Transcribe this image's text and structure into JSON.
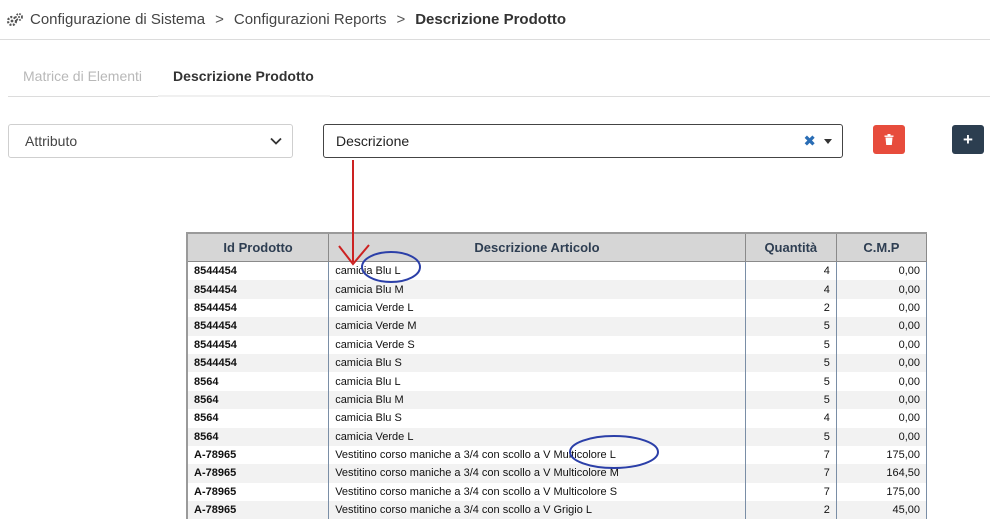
{
  "breadcrumb": {
    "items": [
      "Configurazione di Sistema",
      "Configurazioni Reports"
    ],
    "separator": ">",
    "current": "Descrizione Prodotto"
  },
  "tabs": [
    {
      "label": "Matrice di Elementi",
      "active": false
    },
    {
      "label": "Descrizione Prodotto",
      "active": true
    }
  ],
  "controls": {
    "attribute_select": "Attributo",
    "description_select": "Descrizione",
    "delete_icon": "trash-icon",
    "add_icon": "plus-icon",
    "add_symbol": "+"
  },
  "colors": {
    "delete_button": "#e74c3c",
    "add_button": "#2c3e50",
    "annotation_arrow": "#cc2222",
    "annotation_circle": "#2b3fa8"
  },
  "table": {
    "headers": [
      "Id Prodotto",
      "Descrizione Articolo",
      "Quantità",
      "C.M.P"
    ],
    "rows": [
      [
        "8544454",
        "camicia Blu L",
        "4",
        "0,00"
      ],
      [
        "8544454",
        "camicia Blu M",
        "4",
        "0,00"
      ],
      [
        "8544454",
        "camicia Verde L",
        "2",
        "0,00"
      ],
      [
        "8544454",
        "camicia Verde M",
        "5",
        "0,00"
      ],
      [
        "8544454",
        "camicia Verde S",
        "5",
        "0,00"
      ],
      [
        "8544454",
        "camicia Blu S",
        "5",
        "0,00"
      ],
      [
        "8564",
        "camicia Blu L",
        "5",
        "0,00"
      ],
      [
        "8564",
        "camicia Blu M",
        "5",
        "0,00"
      ],
      [
        "8564",
        "camicia Blu S",
        "4",
        "0,00"
      ],
      [
        "8564",
        "camicia Verde L",
        "5",
        "0,00"
      ],
      [
        "A-78965",
        "Vestitino corso maniche a 3/4 con scollo a V Multicolore L",
        "7",
        "175,00"
      ],
      [
        "A-78965",
        "Vestitino corso maniche a 3/4 con scollo a V Multicolore M",
        "7",
        "164,50"
      ],
      [
        "A-78965",
        "Vestitino corso maniche a 3/4 con scollo a V Multicolore S",
        "7",
        "175,00"
      ],
      [
        "A-78965",
        "Vestitino corso maniche a 3/4 con scollo a V Grigio L",
        "2",
        "45,00"
      ]
    ]
  }
}
